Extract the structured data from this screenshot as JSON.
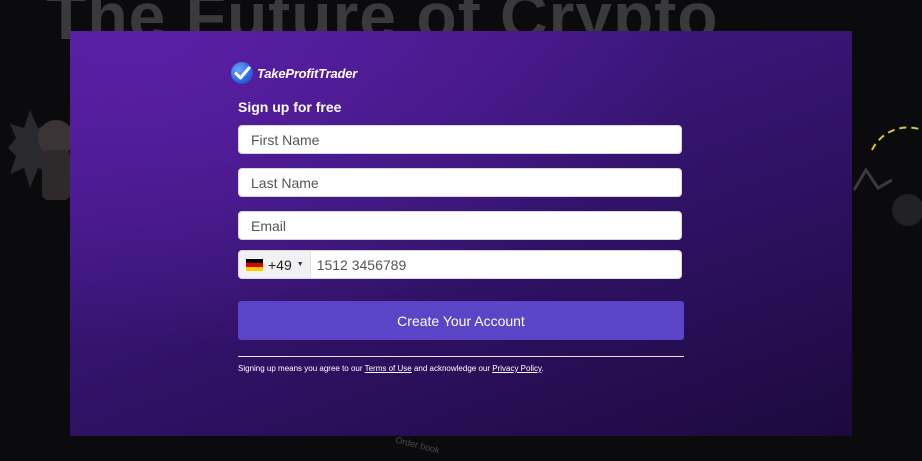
{
  "background": {
    "headline": "The Future of Crypto",
    "bottom_fragment": "Order book"
  },
  "brand": {
    "logo_text": "TakeProfitTrader",
    "logo_color": "#2b64e0"
  },
  "form": {
    "heading": "Sign up for free",
    "first_name_placeholder": "First Name",
    "last_name_placeholder": "Last Name",
    "email_placeholder": "Email",
    "phone": {
      "country": "DE",
      "dial_code": "+49",
      "placeholder": "1512 3456789"
    },
    "submit_label": "Create Your Account",
    "submit_color": "#5a45c7"
  },
  "legal": {
    "prefix": "Signing up means you agree to our ",
    "terms_label": "Terms of Use",
    "middle": " and acknowledge our ",
    "privacy_label": "Privacy Policy",
    "suffix": "."
  }
}
